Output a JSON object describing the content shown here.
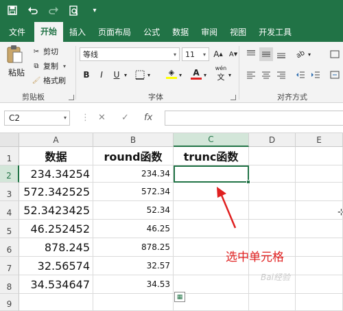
{
  "quick_access": {
    "icons": [
      "save-icon",
      "undo-icon",
      "redo-icon",
      "print-preview-icon",
      "customize-icon"
    ]
  },
  "tabs": [
    "文件",
    "开始",
    "插入",
    "页面布局",
    "公式",
    "数据",
    "审阅",
    "视图",
    "开发工具"
  ],
  "active_tab": "开始",
  "clipboard": {
    "paste": "粘贴",
    "cut": "剪切",
    "copy": "复制",
    "format_painter": "格式刷",
    "group": "剪贴板"
  },
  "font": {
    "name": "等线",
    "size": "11",
    "grow": "A",
    "shrink": "A",
    "bold": "B",
    "italic": "I",
    "underline": "U",
    "phonetic": "wén",
    "group": "字体",
    "fill_color": "#ffff00",
    "font_color": "#e02020"
  },
  "alignment": {
    "group": "对齐方式",
    "orientation": "ab"
  },
  "formula_bar": {
    "name_box": "C2",
    "cancel": "✕",
    "enter": "✓",
    "fx": "fx",
    "value": ""
  },
  "sheet": {
    "columns": [
      "A",
      "B",
      "C",
      "D",
      "E"
    ],
    "selected_column": "C",
    "rows": [
      "1",
      "2",
      "3",
      "4",
      "5",
      "6",
      "7",
      "8",
      "9"
    ],
    "selected_row": "2",
    "headers": [
      "数据",
      "round函数",
      "trunc函数"
    ],
    "data": [
      [
        "234.34254",
        "234.34"
      ],
      [
        "572.342525",
        "572.34"
      ],
      [
        "52.3423425",
        "52.34"
      ],
      [
        "46.252452",
        "46.25"
      ],
      [
        "878.245",
        "878.25"
      ],
      [
        "32.56574",
        "32.57"
      ],
      [
        "34.534647",
        "34.53"
      ]
    ]
  },
  "annotation": {
    "text": "选中单元格",
    "color": "#e02020"
  },
  "watermark": "Bai经验"
}
